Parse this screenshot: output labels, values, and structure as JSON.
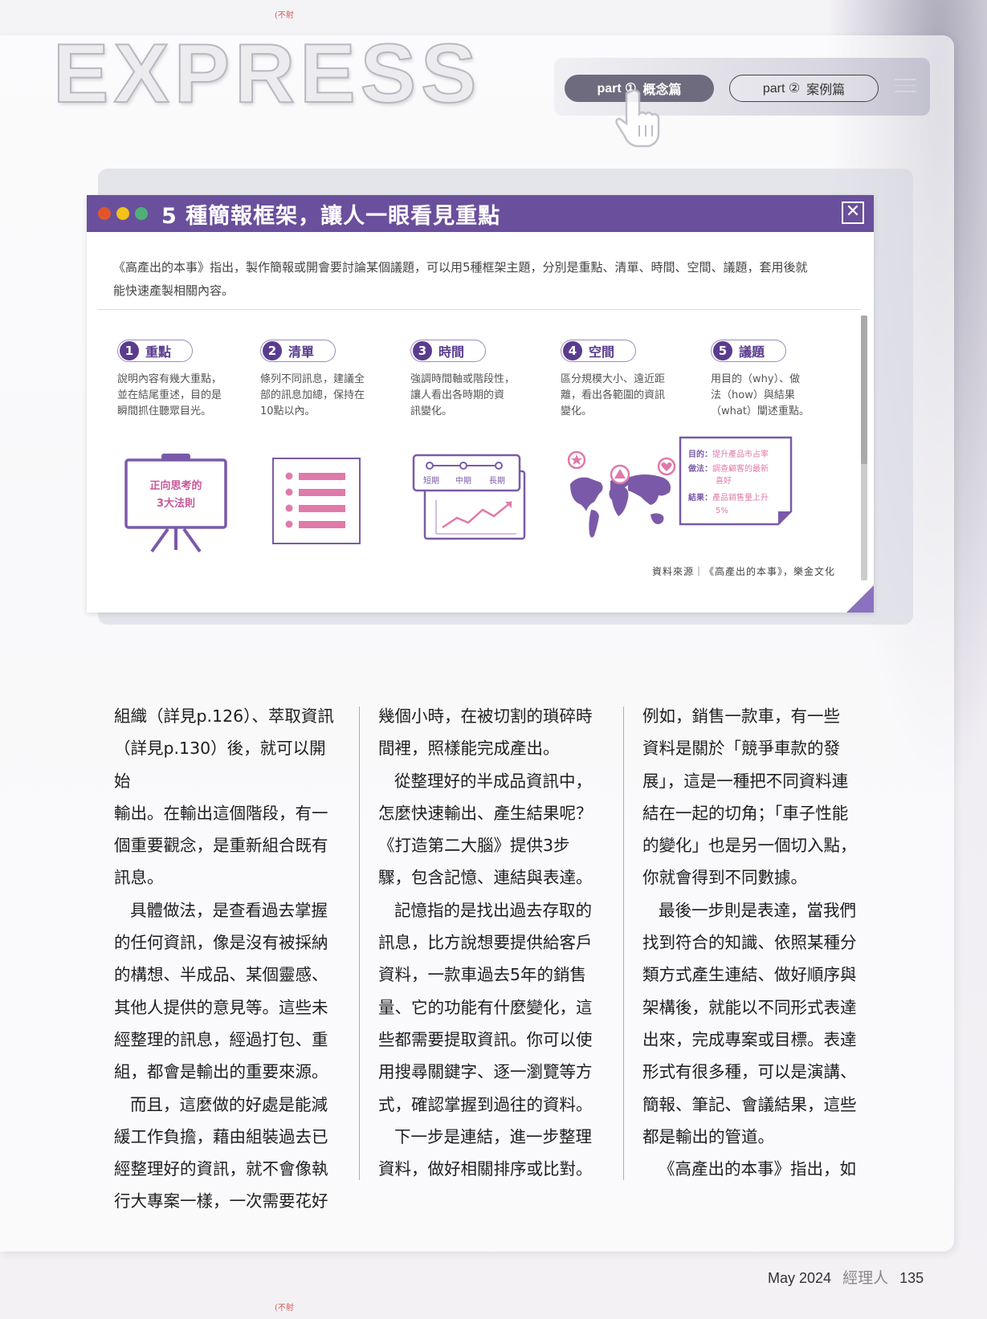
{
  "marks": {
    "top": "(不射",
    "bottom": "(不射"
  },
  "header": {
    "section_title": "EXPRESS",
    "tab1_part": "part ①",
    "tab1_label": "概念篇",
    "tab2_part": "part ②",
    "tab2_label": "案例篇"
  },
  "infographic": {
    "title": "5 種簡報框架，讓人一眼看見重點",
    "intro_line1": "《高產出的本事》指出，製作簡報或開會要討論某個議題，可以用5種框架主題，分別是重點、清單、時間、空間、議題，套用後就",
    "intro_line2": "能快速產製相關內容。",
    "frameworks": [
      {
        "num": "1",
        "name": "重點",
        "desc": [
          "說明內容有幾大重點，",
          "並在結尾重述，目的是",
          "瞬間抓住聽眾目光。"
        ]
      },
      {
        "num": "2",
        "name": "清單",
        "desc": [
          "條列不同訊息，建議全",
          "部的訊息加總，保持在",
          "10點以內。"
        ]
      },
      {
        "num": "3",
        "name": "時間",
        "desc": [
          "強調時間軸或階段性，",
          "讓人看出各時期的資",
          "訊變化。"
        ]
      },
      {
        "num": "4",
        "name": "空間",
        "desc": [
          "區分規模大小、遠近距",
          "離，看出各範圍的資訊",
          "變化。"
        ]
      },
      {
        "num": "5",
        "name": "議題",
        "desc": [
          "用目的（why）、做",
          "法（how）與結果",
          "（what）闡述重點。"
        ]
      }
    ],
    "board_text1": "正向思考的",
    "board_text2": "3大法則",
    "timeline_labels": [
      "短期",
      "中期",
      "長期"
    ],
    "issue_card": {
      "l1a": "目的：",
      "l1b": "提升產品市占率",
      "l2a": "做法：",
      "l2b": "調查顧客的最新",
      "l2c": "喜好",
      "l3a": "結果：",
      "l3b": "產品銷售量上升",
      "l3c": "5%"
    },
    "source": "資料來源｜《高產出的本事》，樂金文化"
  },
  "columns": [
    [
      {
        "t": "組織（詳見p.126）、萃取資訊",
        "i": false
      },
      {
        "t": "（詳見p.130）後，就可以開始",
        "i": false
      },
      {
        "t": "輸出。在輸出這個階段，有一",
        "i": false
      },
      {
        "t": "個重要觀念，是重新組合既有",
        "i": false
      },
      {
        "t": "訊息。",
        "i": false
      },
      {
        "t": "具體做法，是查看過去掌握",
        "i": true
      },
      {
        "t": "的任何資訊，像是沒有被採納",
        "i": false
      },
      {
        "t": "的構想、半成品、某個靈感、",
        "i": false
      },
      {
        "t": "其他人提供的意見等。這些未",
        "i": false
      },
      {
        "t": "經整理的訊息，經過打包、重",
        "i": false
      },
      {
        "t": "組，都會是輸出的重要來源。",
        "i": false
      },
      {
        "t": "而且，這麼做的好處是能減",
        "i": true
      },
      {
        "t": "緩工作負擔，藉由組裝過去已",
        "i": false
      },
      {
        "t": "經整理好的資訊，就不會像執",
        "i": false
      },
      {
        "t": "行大專案一樣，一次需要花好",
        "i": false
      }
    ],
    [
      {
        "t": "幾個小時，在被切割的瑣碎時",
        "i": false
      },
      {
        "t": "間裡，照樣能完成產出。",
        "i": false
      },
      {
        "t": "從整理好的半成品資訊中，",
        "i": true
      },
      {
        "t": "怎麼快速輸出、產生結果呢？",
        "i": false
      },
      {
        "t": "《打造第二大腦》提供3步",
        "i": false
      },
      {
        "t": "驟，包含記憶、連結與表達。",
        "i": false
      },
      {
        "t": "記憶指的是找出過去存取的",
        "i": true
      },
      {
        "t": "訊息，比方說想要提供給客戶",
        "i": false
      },
      {
        "t": "資料，一款車過去5年的銷售",
        "i": false
      },
      {
        "t": "量、它的功能有什麼變化，這",
        "i": false
      },
      {
        "t": "些都需要提取資訊。你可以使",
        "i": false
      },
      {
        "t": "用搜尋關鍵字、逐一瀏覽等方",
        "i": false
      },
      {
        "t": "式，確認掌握到過往的資料。",
        "i": false
      },
      {
        "t": "下一步是連結，進一步整理",
        "i": true
      },
      {
        "t": "資料，做好相關排序或比對。",
        "i": false
      }
    ],
    [
      {
        "t": "例如，銷售一款車，有一些",
        "i": false
      },
      {
        "t": "資料是關於「競爭車款的發",
        "i": false
      },
      {
        "t": "展」，這是一種把不同資料連",
        "i": false
      },
      {
        "t": "結在一起的切角；「車子性能",
        "i": false
      },
      {
        "t": "的變化」也是另一個切入點，",
        "i": false
      },
      {
        "t": "你就會得到不同數據。",
        "i": false
      },
      {
        "t": "最後一步則是表達，當我們",
        "i": true
      },
      {
        "t": "找到符合的知識、依照某種分",
        "i": false
      },
      {
        "t": "類方式產生連結、做好順序與",
        "i": false
      },
      {
        "t": "架構後，就能以不同形式表達",
        "i": false
      },
      {
        "t": "出來，完成專案或目標。表達",
        "i": false
      },
      {
        "t": "形式有很多種，可以是演講、",
        "i": false
      },
      {
        "t": "簡報、筆記、會議結果，這些",
        "i": false
      },
      {
        "t": "都是輸出的管道。",
        "i": false
      },
      {
        "t": "《高產出的本事》指出，如",
        "i": true
      }
    ]
  ],
  "footer": {
    "date": "May 2024",
    "magazine": "經理人",
    "page": "135"
  },
  "colors": {
    "purple": "#6a4f9c",
    "pink": "#e07aa8",
    "light_purple": "#8b72c0"
  }
}
